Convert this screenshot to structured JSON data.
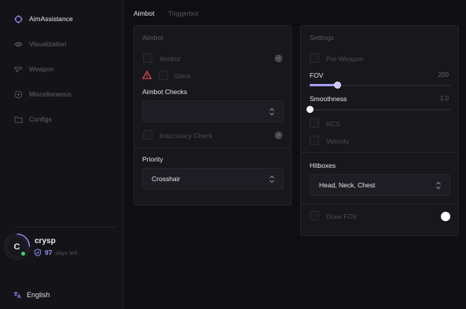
{
  "sidebar": {
    "items": [
      {
        "label": "AimAssistance",
        "icon": "crosshair-icon",
        "active": true
      },
      {
        "label": "Visualization",
        "icon": "eye-icon",
        "active": false
      },
      {
        "label": "Weapon",
        "icon": "gun-icon",
        "active": false
      },
      {
        "label": "Miscellaneous",
        "icon": "plus-circle-icon",
        "active": false
      },
      {
        "label": "Configs",
        "icon": "folder-icon",
        "active": false
      }
    ],
    "profile": {
      "avatar_letter": "C",
      "username": "crysp",
      "days_count": "97",
      "days_label": "days left",
      "status": "online"
    },
    "language": {
      "label": "English",
      "icon": "translate-icon"
    }
  },
  "tabs": [
    {
      "label": "Aimbot",
      "active": true
    },
    {
      "label": "Triggerbot",
      "active": false
    }
  ],
  "aimbot_panel": {
    "title": "Aimbot",
    "aimbot_label": "Aimbot",
    "silent_label": "Silent",
    "checks_title": "Aimbot Checks",
    "checks_value": "",
    "inaccuracy_label": "Inaccuracy Check",
    "priority_title": "Priority",
    "priority_value": "Crosshair"
  },
  "settings_panel": {
    "title": "Settings",
    "per_weapon_label": "Per-Weapon",
    "fov_label": "FOV",
    "fov_value": "200",
    "fov_fraction": 0.2,
    "smoothness_label": "Smoothness",
    "smoothness_value": "1.0",
    "smoothness_fraction": 0.0,
    "rcs_label": "RCS",
    "velocity_label": "Velocity",
    "hitboxes_title": "Hitboxes",
    "hitboxes_value": "Head, Neck, Chest",
    "draw_fov_label": "Draw FOV"
  },
  "colors": {
    "accent": "#a49cff",
    "online": "#3fd467",
    "warning": "#e04848",
    "background": "#0f0f13",
    "panel": "#17171c"
  }
}
